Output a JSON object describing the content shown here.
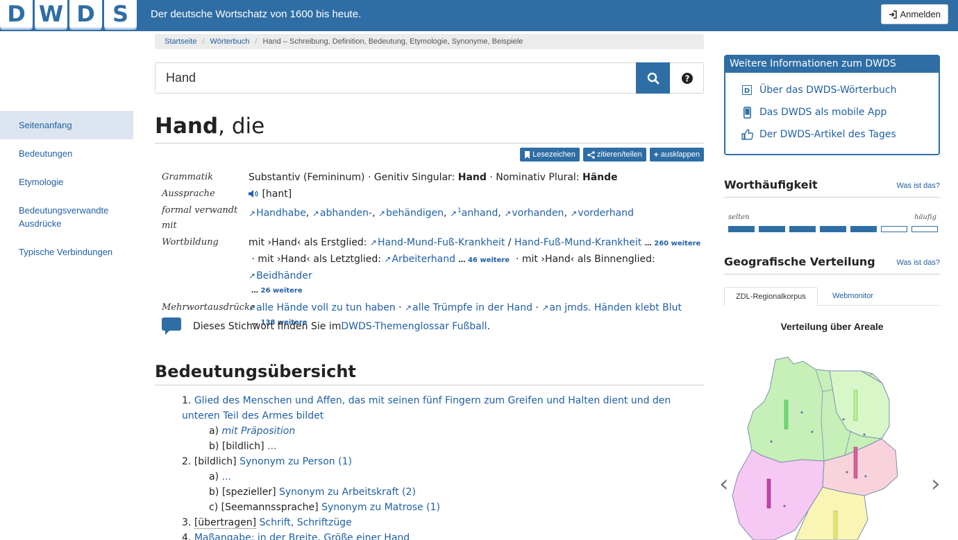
{
  "header": {
    "logo_letters": [
      "D",
      "W",
      "D",
      "S"
    ],
    "tagline": "Der deutsche Wortschatz von 1600 bis heute.",
    "login_label": "Anmelden",
    "brand_color": "#2f6ea5"
  },
  "breadcrumb": {
    "items": [
      "Startseite",
      "Wörterbuch"
    ],
    "current": "Hand – Schreibung, Definition, Bedeutung, Etymologie, Synonyme, Beispiele"
  },
  "search": {
    "value": "Hand",
    "search_icon": "search-icon",
    "help_icon": "question-circle-icon"
  },
  "leftnav": {
    "items": [
      "Seitenanfang",
      "Bedeutungen",
      "Etymologie",
      "Bedeutungsverwandte Ausdrücke",
      "Typische Verbindungen"
    ],
    "active_index": 0
  },
  "entry": {
    "lemma": "Hand",
    "article": ", die",
    "actions": {
      "bookmark": "Lesezeichen",
      "cite": "zitieren/teilen",
      "expand": "ausklappen"
    },
    "grammar_label": "Grammatik",
    "grammar_pre": "Substantiv (Femininum) · Genitiv Singular: ",
    "grammar_gen": "Hand",
    "grammar_mid": " · Nominativ Plural: ",
    "grammar_pl": "Hände",
    "pron_label": "Aussprache",
    "pron": "[hant]",
    "related_label": "formal verwandt mit",
    "related": [
      "Handhabe",
      "abhanden-",
      "behändigen",
      "anhand",
      "vorhanden",
      "vorderhand"
    ],
    "related_sup": "1",
    "wb_label": "Wortbildung",
    "wb_first_pre": "mit ›Hand‹ als Erstglied: ",
    "wb_first_a": "Hand-Mund-Fuß-Krankheit",
    "wb_first_sep": " / ",
    "wb_first_b": "Hand-Fuß-Mund-Krankheit",
    "wb_first_more": "260 weitere",
    "wb_last_pre": "mit ›Hand‹ als Letztglied: ",
    "wb_last_a": "Arbeiterhand",
    "wb_last_more": "46 weitere",
    "wb_mid_pre": "mit ›Hand‹ als Binnenglied: ",
    "wb_mid_a": "Beidhänder",
    "wb_mid_more": "26 weitere",
    "mwa_label": "Mehrwortausdrücke",
    "mwa": [
      "alle Hände voll zu tun haben",
      "alle Trümpfe in der Hand",
      "an jmds. Händen klebt Blut"
    ],
    "mwa_more": "138 weitere",
    "glossar_pre": "Dieses Stichwort finden Sie im ",
    "glossar_link": "DWDS-Themenglossar Fußball"
  },
  "overview": {
    "title": "Bedeutungsübersicht",
    "m1_num": "1.",
    "m1_text": "Glied des Menschen und Affen, das mit seinen fünf Fingern zum Greifen und Halten dient und den unteren Teil des Armes bildet",
    "m1a_num": "a)",
    "m1a_text": "mit Präposition",
    "m1b_num": "b)",
    "m1b_tag": "[bildlich]",
    "m1b_text": "...",
    "m2_num": "2.",
    "m2_tag": "[bildlich]",
    "m2_text": "Synonym zu Person (1)",
    "m2a_num": "a)",
    "m2a_text": "...",
    "m2b_num": "b)",
    "m2b_tag": "[spezieller]",
    "m2b_text": "Synonym zu Arbeitskraft (2)",
    "m2c_num": "c)",
    "m2c_tag": "[Seemannssprache]",
    "m2c_text": "Synonym zu Matrose (1)",
    "m3_num": "3.",
    "m3_tag": "[übertragen]",
    "m3_text": "Schrift, Schriftzüge",
    "m4_num": "4.",
    "m4_text": "Maßangabe: in der Breite, Größe einer Hand"
  },
  "sidebar": {
    "infobox_title": "Weitere Informationen zum DWDS",
    "infobox_items": [
      "Über das DWDS-Wörterbuch",
      "Das DWDS als mobile App",
      "Der DWDS-Artikel des Tages"
    ],
    "freq_title": "Worthäufigkeit",
    "freq_link": "Was ist das?",
    "freq_low": "selten",
    "freq_high": "häufig",
    "freq_level": 5,
    "freq_max": 7,
    "geo_title": "Geografische Verteilung",
    "geo_link": "Was ist das?",
    "geo_tabs": [
      "ZDL-Regionalkorpus",
      "Webmonitor"
    ],
    "geo_active_tab": 0,
    "map_title": "Verteilung über Areale"
  }
}
